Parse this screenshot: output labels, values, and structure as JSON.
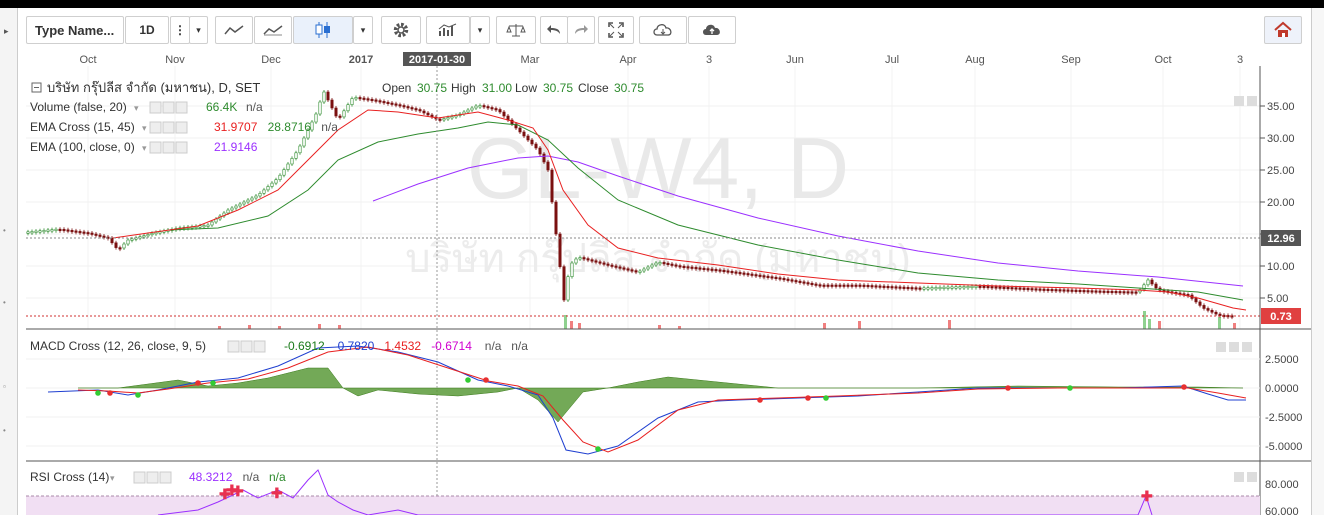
{
  "toolbar": {
    "symbol": "Type Name...",
    "interval": "1D"
  },
  "time_axis": {
    "labels": [
      "Oct",
      "Nov",
      "Dec",
      "2017",
      "Mar",
      "Apr",
      "3",
      "Jun",
      "Jul",
      "Aug",
      "Sep",
      "Oct",
      "3"
    ],
    "crosshair_label": "2017-01-30"
  },
  "main_pane": {
    "title": "บริษัท กรุ๊ปลีส จำกัด (มหาชน), D, SET",
    "ohlc": {
      "open_label": "Open",
      "open": "30.75",
      "high_label": "High",
      "high": "31.00",
      "low_label": "Low",
      "low": "30.75",
      "close_label": "Close",
      "close": "30.75"
    },
    "watermark_symbol": "GL-W4, D",
    "watermark_name": "บริษัท กรุ๊ปลีส จำกัด (มหาชน)",
    "indicators": [
      {
        "label": "Volume (false, 20)",
        "values": [
          "66.4K",
          "n/a"
        ],
        "colors": [
          "#2e8b2e",
          "#555555"
        ]
      },
      {
        "label": "EMA Cross (15, 45)",
        "values": [
          "31.9707",
          "28.8716",
          "n/a"
        ],
        "colors": [
          "#e82020",
          "#2e8b2e",
          "#555555"
        ]
      },
      {
        "label": "EMA (100, close, 0)",
        "values": [
          "21.9146"
        ],
        "colors": [
          "#9b30ff"
        ]
      }
    ],
    "price_ticks": [
      "35.00",
      "30.00",
      "25.00",
      "20.00",
      "15.00",
      "10.00",
      "5.00"
    ],
    "crosshair_price": "12.96",
    "last_price": "0.73"
  },
  "macd_pane": {
    "label": "MACD Cross (12, 26, close, 9, 5)",
    "values": [
      "-0.6912",
      "0.7820",
      "1.4532",
      "-0.6714",
      "n/a",
      "n/a"
    ],
    "colors": [
      "#1a7a1a",
      "#1f3fd0",
      "#e82020",
      "#d000d0",
      "#555555",
      "#555555"
    ],
    "ticks": [
      "2.5000",
      "0.0000",
      "-2.5000",
      "-5.0000"
    ]
  },
  "rsi_pane": {
    "label": "RSI Cross (14)",
    "values": [
      "48.3212",
      "n/a",
      "n/a"
    ],
    "colors": [
      "#9b30ff",
      "#555555",
      "#2e8b2e"
    ],
    "ticks": [
      "80.000",
      "60.000"
    ]
  },
  "colors": {
    "up": "#2e8b2e",
    "down": "#d03030",
    "ema_fast": "#e82020",
    "ema_slow": "#2e8b2e",
    "ema_100": "#9b30ff",
    "macd": "#1f3fd0",
    "signal": "#e82020",
    "histogram": "#3a7a1a",
    "rsi": "#9b30ff"
  }
}
